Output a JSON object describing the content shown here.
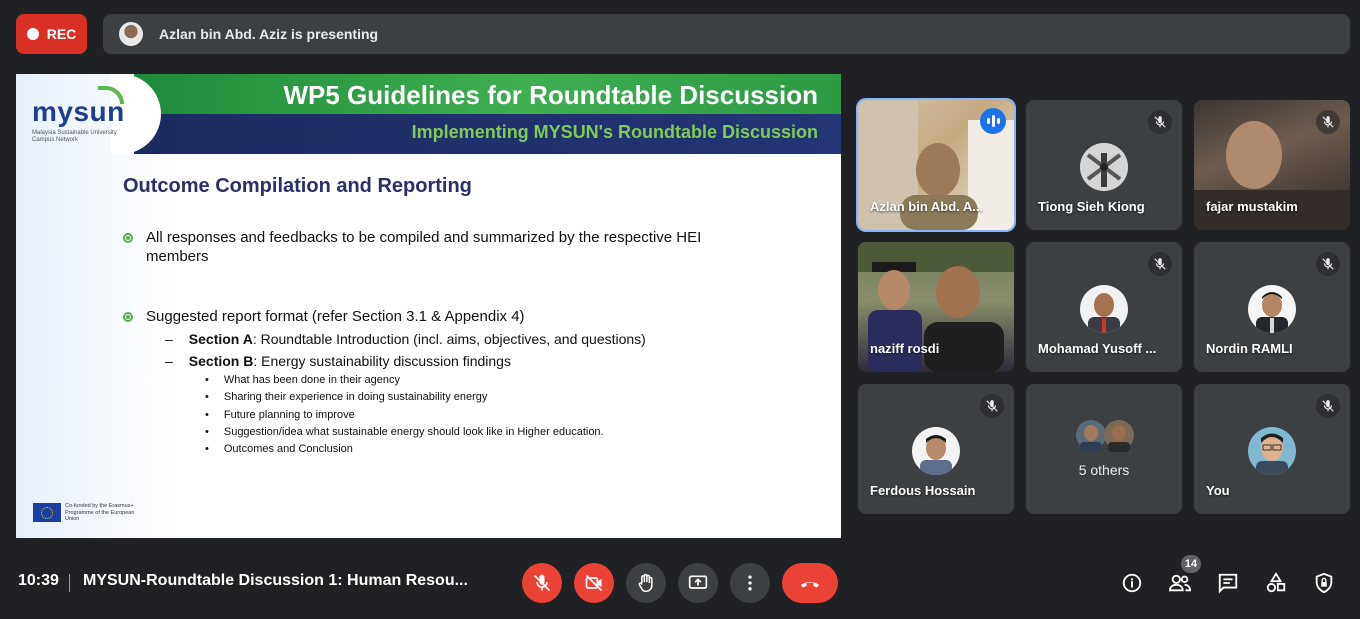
{
  "recording": {
    "label": "REC"
  },
  "presenter_banner": {
    "text": "Azlan bin Abd. Aziz is presenting"
  },
  "slide": {
    "title": "WP5 Guidelines for Roundtable Discussion",
    "subtitle": "Implementing MYSUN's Roundtable Discussion",
    "logo_word": "mysun",
    "logo_sub": "Malaysia Sustainable University Campus Network",
    "heading": "Outcome Compilation and Reporting",
    "bullet1": "All responses and feedbacks to be compiled and summarized by the respective HEI members",
    "bullet2": "Suggested report format (refer Section 3.1 & Appendix 4)",
    "section_a_label": "Section A",
    "section_a_text": ": Roundtable Introduction (incl. aims, objectives, and questions)",
    "section_b_label": "Section B",
    "section_b_text": ": Energy sustainability discussion findings",
    "dash": "–",
    "dot": "•",
    "sub_items": [
      "What has been done in their agency",
      "Sharing their experience in doing sustainability energy",
      "Future planning to improve",
      "Suggestion/idea what sustainable energy should look like in Higher education.",
      "Outcomes and Conclusion"
    ],
    "eu_text": "Co-funded by the Erasmus+ Programme of the European Union"
  },
  "participants": {
    "azlan": "Azlan bin Abd. A...",
    "tiong": "Tiong Sieh Kiong",
    "fajar": "fajar mustakim",
    "naziff": "naziff rosdi",
    "mohamad": "Mohamad Yusoff ...",
    "nordin": "Nordin RAMLI",
    "ferdous": "Ferdous Hossain",
    "others": "5 others",
    "you": "You"
  },
  "bottom": {
    "time": "10:39",
    "meeting_title": "MYSUN-Roundtable Discussion 1: Human Resou...",
    "people_count": "14"
  },
  "colors": {
    "background": "#202124",
    "tile": "#3c4043",
    "danger": "#ea4335",
    "speaking": "#1a73e8"
  }
}
